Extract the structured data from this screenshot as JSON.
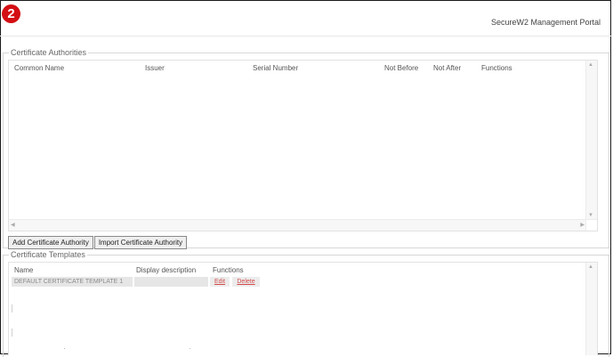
{
  "badge": "2",
  "header": {
    "portal_title": "SecureW2 Management Portal"
  },
  "certificate_authorities": {
    "legend": "Certificate Authorities",
    "columns": [
      "Common Name",
      "Issuer",
      "Serial Number",
      "Not Before",
      "Not After",
      "Functions"
    ],
    "rows": [],
    "buttons": {
      "add": "Add Certificate Authority",
      "import": "Import Certificate Authority"
    }
  },
  "certificate_templates": {
    "legend": "Certificate Templates",
    "columns": [
      "Name",
      "Display description",
      "Functions"
    ],
    "rows": [
      {
        "name": "DEFAULT CERTIFICATE TEMPLATE 1",
        "description": "",
        "edit": "Edit",
        "delete": "Delete"
      }
    ]
  },
  "colors": {
    "badge": "#d40f14",
    "link": "#d24a4a"
  }
}
